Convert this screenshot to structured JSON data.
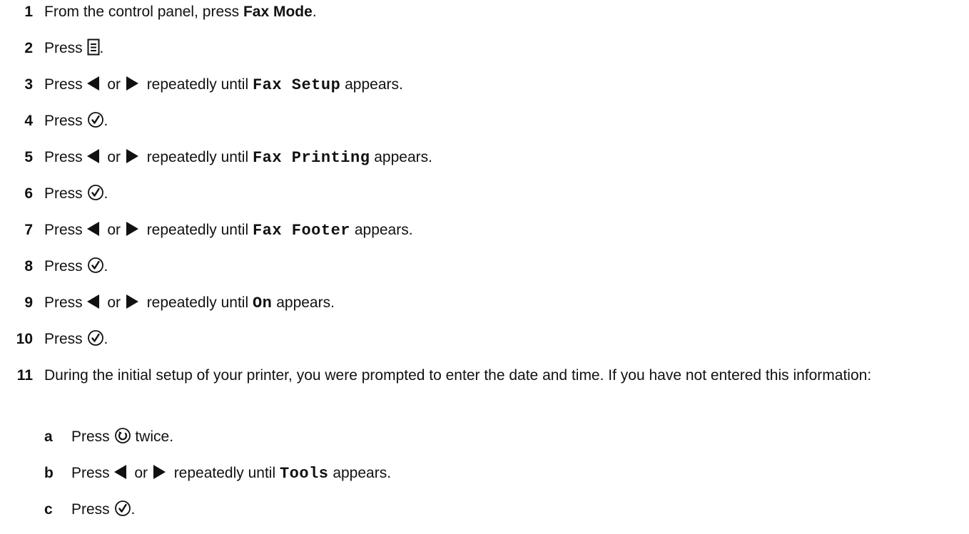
{
  "steps": [
    {
      "num": "1",
      "pre": "From the control panel, press ",
      "bold": "Fax Mode",
      "post": "."
    },
    {
      "num": "2",
      "pre": "Press ",
      "icon": "menu-icon",
      "post": "."
    },
    {
      "num": "3",
      "pre": "Press ",
      "mid": " or ",
      "after": " repeatedly until ",
      "code": "Fax Setup",
      "post": " appears."
    },
    {
      "num": "4",
      "pre": "Press ",
      "icon": "select-check-icon",
      "post": "."
    },
    {
      "num": "5",
      "pre": "Press ",
      "mid": " or ",
      "after": " repeatedly until ",
      "code": "Fax Printing",
      "post": " appears."
    },
    {
      "num": "6",
      "pre": "Press ",
      "icon": "select-check-icon",
      "post": "."
    },
    {
      "num": "7",
      "pre": "Press ",
      "mid": " or ",
      "after": " repeatedly until ",
      "code": "Fax Footer",
      "post": " appears."
    },
    {
      "num": "8",
      "pre": "Press ",
      "icon": "select-check-icon",
      "post": "."
    },
    {
      "num": "9",
      "pre": "Press ",
      "mid": " or ",
      "after": " repeatedly until ",
      "code": "On",
      "post": " appears."
    },
    {
      "num": "10",
      "pre": "Press ",
      "icon": "select-check-icon",
      "post": "."
    },
    {
      "num": "11",
      "text": "During the initial setup of your printer, you were prompted to enter the date and time. If you have not entered this information:"
    }
  ],
  "substeps": [
    {
      "letter": "a",
      "pre": "Press ",
      "icon": "back-icon",
      "post": " twice."
    },
    {
      "letter": "b",
      "pre": "Press ",
      "mid": " or ",
      "after": " repeatedly until ",
      "code": "Tools",
      "post": " appears."
    },
    {
      "letter": "c",
      "pre": "Press ",
      "icon": "select-check-icon",
      "post": "."
    }
  ]
}
